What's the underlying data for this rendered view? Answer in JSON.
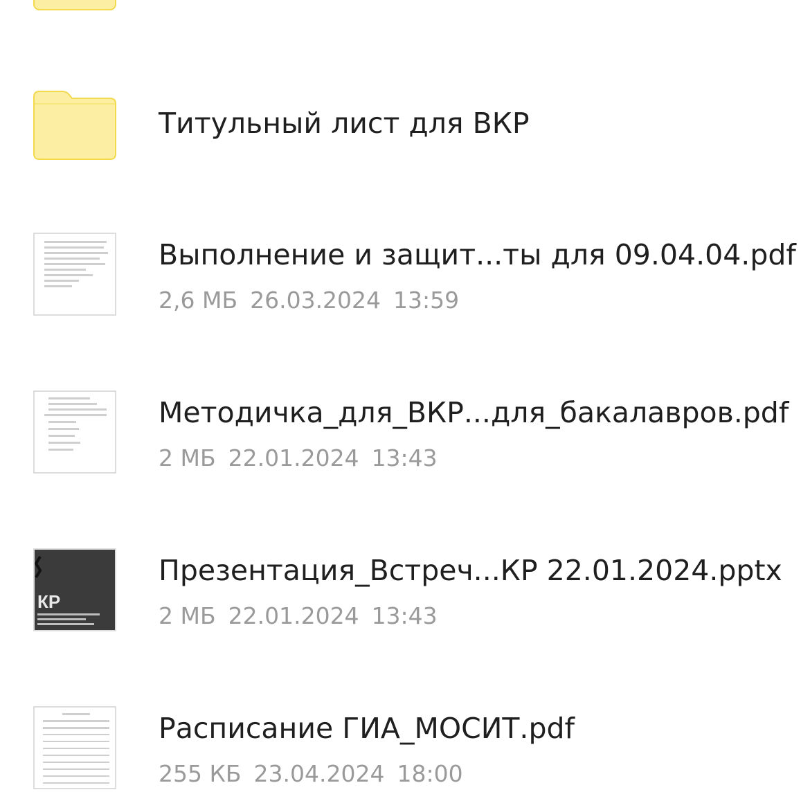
{
  "items": [
    {
      "type": "folder",
      "icon": "folder-icon",
      "color": "#FCEFA4"
    },
    {
      "type": "folder",
      "icon": "folder-icon",
      "color": "#FCEFA4",
      "name": "Титульный лист для ВКР"
    },
    {
      "type": "file",
      "icon": "pdf-thumbnail",
      "name": "Выполнение и защит...ты для 09.04.04.pdf",
      "size": "2,6 МБ",
      "date": "26.03.2024",
      "time": "13:59"
    },
    {
      "type": "file",
      "icon": "pdf-thumbnail",
      "name": "Методичка_для_ВКР...для_бакалавров.pdf",
      "size": "2 МБ",
      "date": "22.01.2024",
      "time": "13:43"
    },
    {
      "type": "file",
      "icon": "pptx-thumbnail",
      "name": "Презентация_Встреч...КР 22.01.2024.pptx",
      "size": "2 МБ",
      "date": "22.01.2024",
      "time": "13:43"
    },
    {
      "type": "file",
      "icon": "pdf-thumbnail",
      "name": "Расписание ГИА_МОСИТ.pdf",
      "size": "255 КБ",
      "date": "23.04.2024",
      "time": "18:00"
    }
  ],
  "colors": {
    "folder_fill": "#FCEFA4",
    "folder_stroke": "#F2D94E",
    "title_text": "#1F1F1F",
    "meta_text": "#9A9A9A"
  }
}
